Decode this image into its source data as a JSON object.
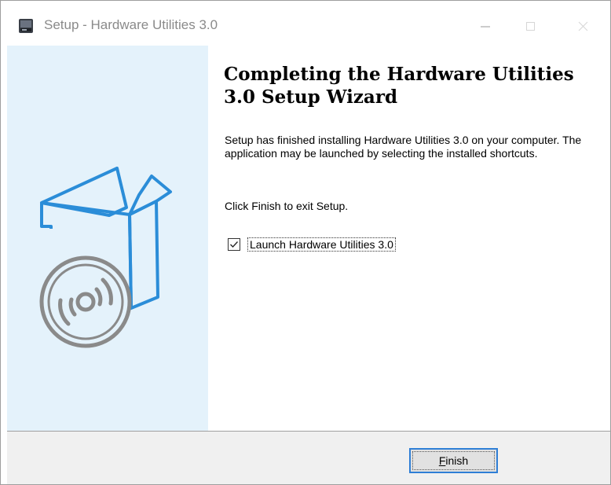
{
  "window": {
    "title": "Setup - Hardware Utilities 3.0",
    "controls": [
      "minimize-icon",
      "maximize-icon",
      "close-icon"
    ]
  },
  "side_panel": {
    "graphic": "software-box-with-disc-icon",
    "background": "#e4f2fb",
    "accent": "#2b8dd8"
  },
  "content": {
    "heading": "Completing the Hardware Utilities 3.0 Setup Wizard",
    "description": "Setup has finished installing Hardware Utilities 3.0 on your computer. The application may be launched by selecting the installed shortcuts.",
    "exit_text": "Click Finish to exit Setup.",
    "launch_checkbox": {
      "label": "Launch Hardware Utilities 3.0",
      "checked": true
    }
  },
  "footer": {
    "finish_button": {
      "mnemonic": "F",
      "rest": "inish"
    }
  }
}
